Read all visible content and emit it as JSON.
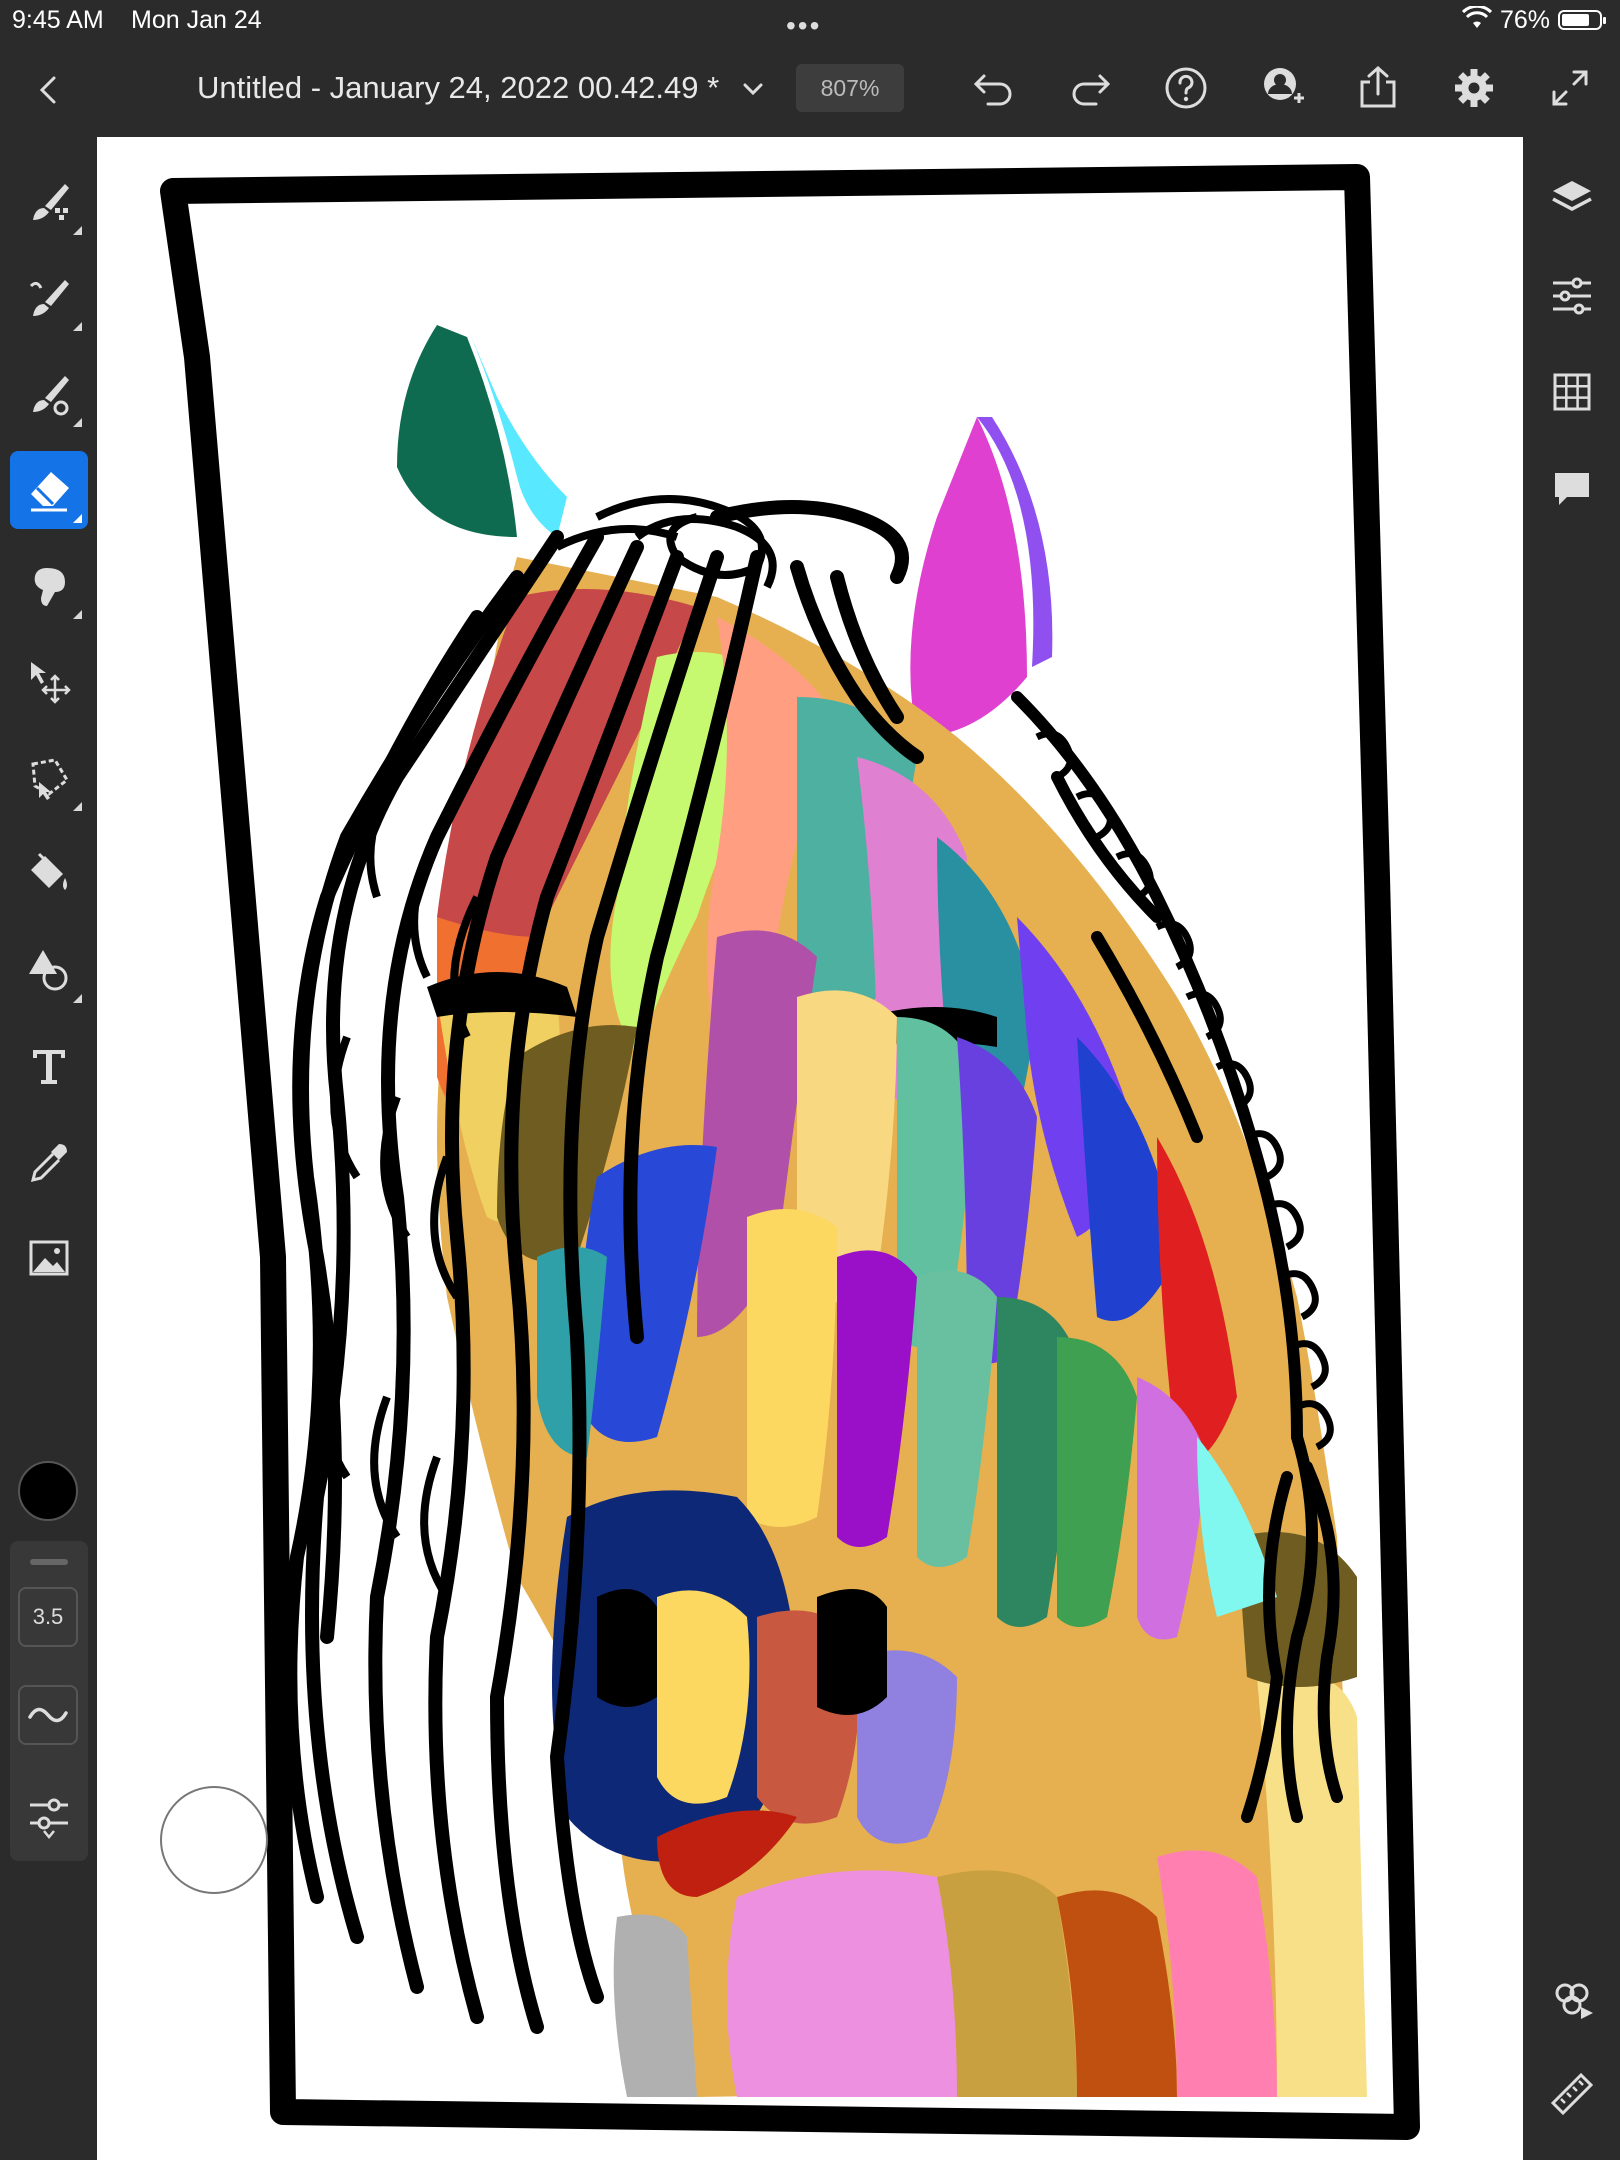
{
  "status_bar": {
    "time": "9:45 AM",
    "date": "Mon Jan 24",
    "battery_percent": "76%",
    "battery_level": 0.76
  },
  "top_bar": {
    "document_title": "Untitled - January 24, 2022 00.42.49 *",
    "zoom_level": "807%",
    "icons": [
      "back-icon",
      "title-dropdown-icon",
      "undo-icon",
      "redo-icon",
      "help-icon",
      "invite-icon",
      "share-icon",
      "settings-icon",
      "fullscreen-icon"
    ]
  },
  "left_toolbar": {
    "tools": [
      "pixel-brush-icon",
      "live-brush-icon",
      "vector-brush-icon",
      "eraser-icon",
      "smudge-icon",
      "transform-icon",
      "selection-icon",
      "fill-icon",
      "shapes-icon",
      "text-icon",
      "eyedropper-icon",
      "image-icon"
    ],
    "active_tool": "eraser",
    "current_color": "#000000",
    "brush_size": "3.5"
  },
  "right_toolbar": {
    "tools": [
      "layers-icon",
      "adjustments-icon",
      "grid-icon",
      "comments-icon",
      "livestream-icon",
      "ruler-icon"
    ]
  },
  "colors": {
    "accent": "#1473e6",
    "chrome": "#2b2b2b",
    "canvas": "#ffffff"
  }
}
